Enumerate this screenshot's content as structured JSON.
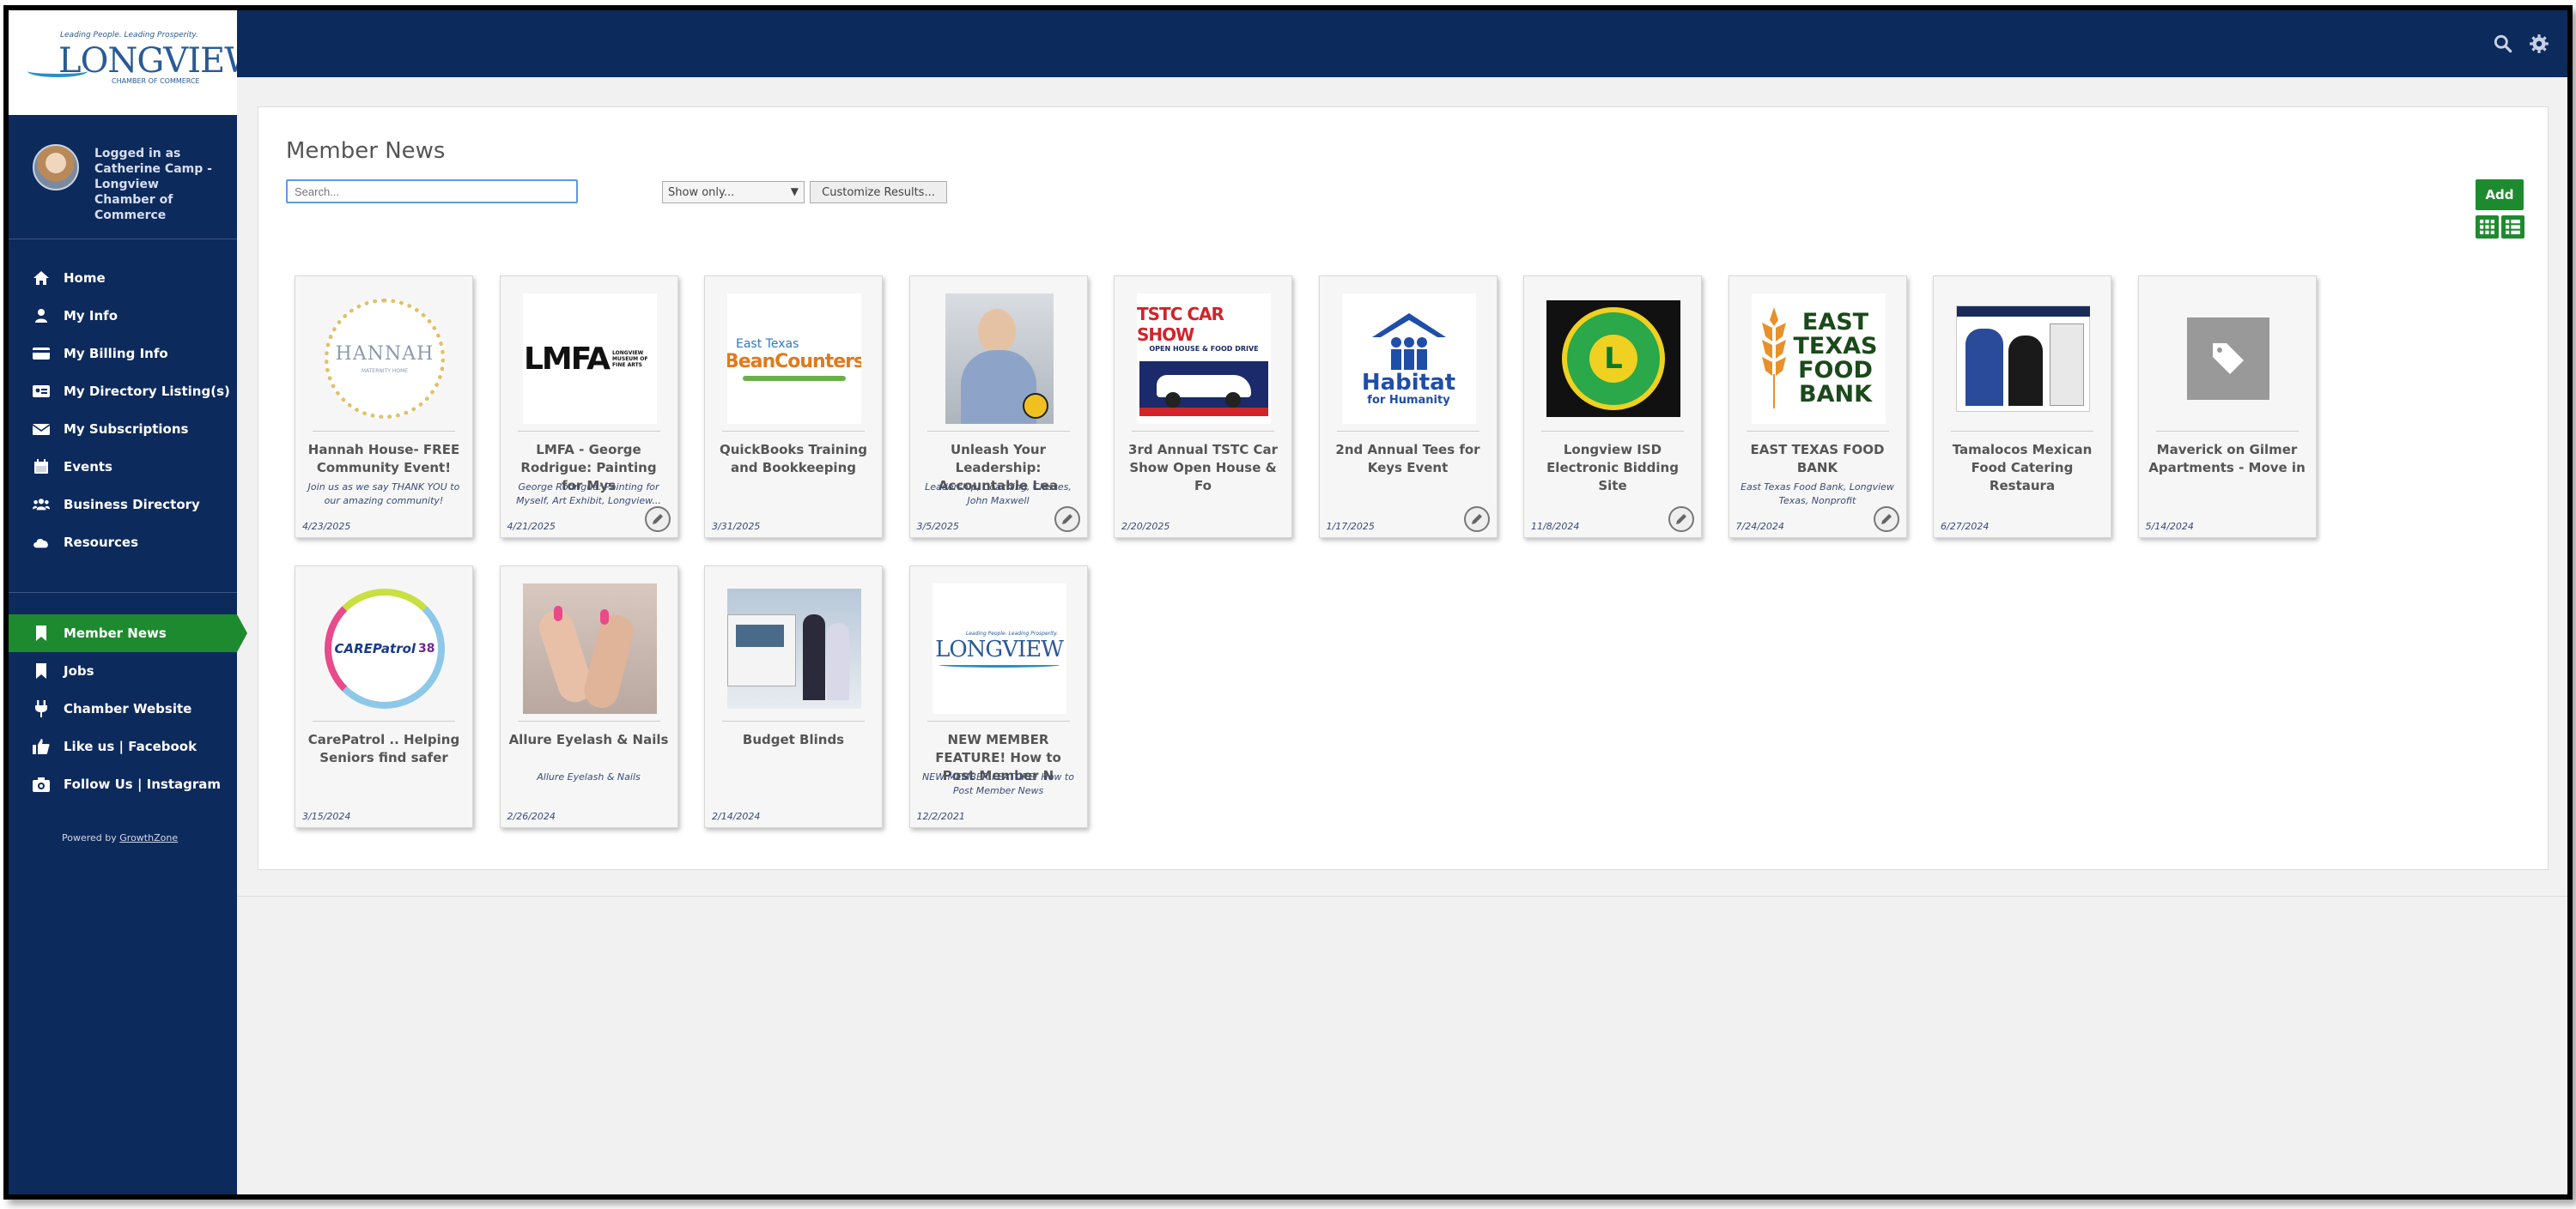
{
  "logo": {
    "tagline": "Leading People. Leading Prosperity.",
    "name": "LONGVIEW",
    "sub": "CHAMBER OF COMMERCE"
  },
  "user": {
    "logged_in_text": "Logged in as Catherine Camp - Longview Chamber of Commerce"
  },
  "nav_primary": [
    {
      "label": "Home",
      "icon": "home-icon"
    },
    {
      "label": "My Info",
      "icon": "user-icon"
    },
    {
      "label": "My Billing Info",
      "icon": "credit-card-icon"
    },
    {
      "label": "My Directory Listing(s)",
      "icon": "id-card-icon"
    },
    {
      "label": "My Subscriptions",
      "icon": "envelope-icon"
    },
    {
      "label": "Events",
      "icon": "calendar-icon"
    },
    {
      "label": "Business Directory",
      "icon": "users-icon"
    },
    {
      "label": "Resources",
      "icon": "cloud-icon"
    }
  ],
  "nav_secondary": [
    {
      "label": "Member News",
      "icon": "bookmark-icon",
      "active": true
    },
    {
      "label": "Jobs",
      "icon": "bookmark-icon"
    },
    {
      "label": "Chamber Website",
      "icon": "plug-icon"
    },
    {
      "label": "Like us | Facebook",
      "icon": "thumbs-up-icon"
    },
    {
      "label": "Follow Us | Instagram",
      "icon": "camera-icon"
    }
  ],
  "powered_by": {
    "prefix": "Powered by",
    "link": "GrowthZone"
  },
  "page": {
    "title": "Member News",
    "search_placeholder": "Search...",
    "filter_selected": "Show only...",
    "customize_label": "Customize Results...",
    "add_label": "Add"
  },
  "cards": [
    {
      "title": "Hannah House- FREE Community Event!",
      "desc": "Join us as we say THANK YOU to our amazing community!",
      "date": "4/23/2025",
      "editable": false,
      "img_text": "HANNAH",
      "img_sub": "MATERNITY HOME"
    },
    {
      "title": "LMFA - George Rodrigue: Painting for Mys",
      "desc": "George Rodrigue: Painting for Myself, Art Exhibit, Longview...",
      "date": "4/21/2025",
      "editable": true,
      "img_text": "LMFA",
      "img_sub": "LONGVIEW MUSEUM OF FINE ARTS"
    },
    {
      "title": "QuickBooks Training and Bookkeeping",
      "desc": "",
      "date": "3/31/2025",
      "editable": false,
      "img_text": "East Texas",
      "img_sub": "BeanCounters"
    },
    {
      "title": "Unleash Your Leadership: Accountable Lea",
      "desc": "Leadership, Coaching, Classes, John Maxwell",
      "date": "3/5/2025",
      "editable": true,
      "img_text": "",
      "img_sub": ""
    },
    {
      "title": "3rd Annual TSTC Car Show Open House & Fo",
      "desc": "",
      "date": "2/20/2025",
      "editable": false,
      "img_text": "TSTC CAR SHOW",
      "img_sub": "OPEN HOUSE & FOOD DRIVE"
    },
    {
      "title": "2nd Annual Tees for Keys Event",
      "desc": "",
      "date": "1/17/2025",
      "editable": true,
      "img_text": "Habitat",
      "img_sub": "for Humanity"
    },
    {
      "title": "Longview ISD Electronic Bidding Site",
      "desc": "",
      "date": "11/8/2024",
      "editable": true,
      "img_text": "L",
      "img_sub": ""
    },
    {
      "title": "EAST TEXAS FOOD BANK",
      "desc": "East Texas Food Bank, Longview Texas, Nonprofit",
      "date": "7/24/2024",
      "editable": true,
      "img_text": "EAST TEXAS FOOD BANK",
      "img_sub": ""
    },
    {
      "title": "Tamalocos Mexican Food Catering Restaura",
      "desc": "",
      "date": "6/27/2024",
      "editable": false,
      "img_text": "",
      "img_sub": ""
    },
    {
      "title": "Maverick on Gilmer Apartments - Move in",
      "desc": "",
      "date": "5/14/2024",
      "editable": false,
      "img_text": "",
      "img_sub": ""
    },
    {
      "title": "CarePatrol .. Helping Seniors find safer",
      "desc": "",
      "date": "3/15/2024",
      "editable": false,
      "img_text": "CAREPatrol",
      "img_sub": "38"
    },
    {
      "title": "Allure Eyelash & Nails",
      "desc": "Allure Eyelash & Nails",
      "date": "2/26/2024",
      "editable": false,
      "img_text": "",
      "img_sub": ""
    },
    {
      "title": "Budget Blinds",
      "desc": "",
      "date": "2/14/2024",
      "editable": false,
      "img_text": "",
      "img_sub": ""
    },
    {
      "title": "NEW MEMBER FEATURE! How to Post Member N",
      "desc": "NEW MEMBER FEATURE! How to Post Member News",
      "date": "12/2/2021",
      "editable": false,
      "img_text": "LONGVIEW",
      "img_sub": "Leading People. Leading Prosperity."
    }
  ],
  "colors": {
    "navy": "#0d2a5c",
    "green": "#1e8a2f",
    "link": "#3a4a7a"
  }
}
